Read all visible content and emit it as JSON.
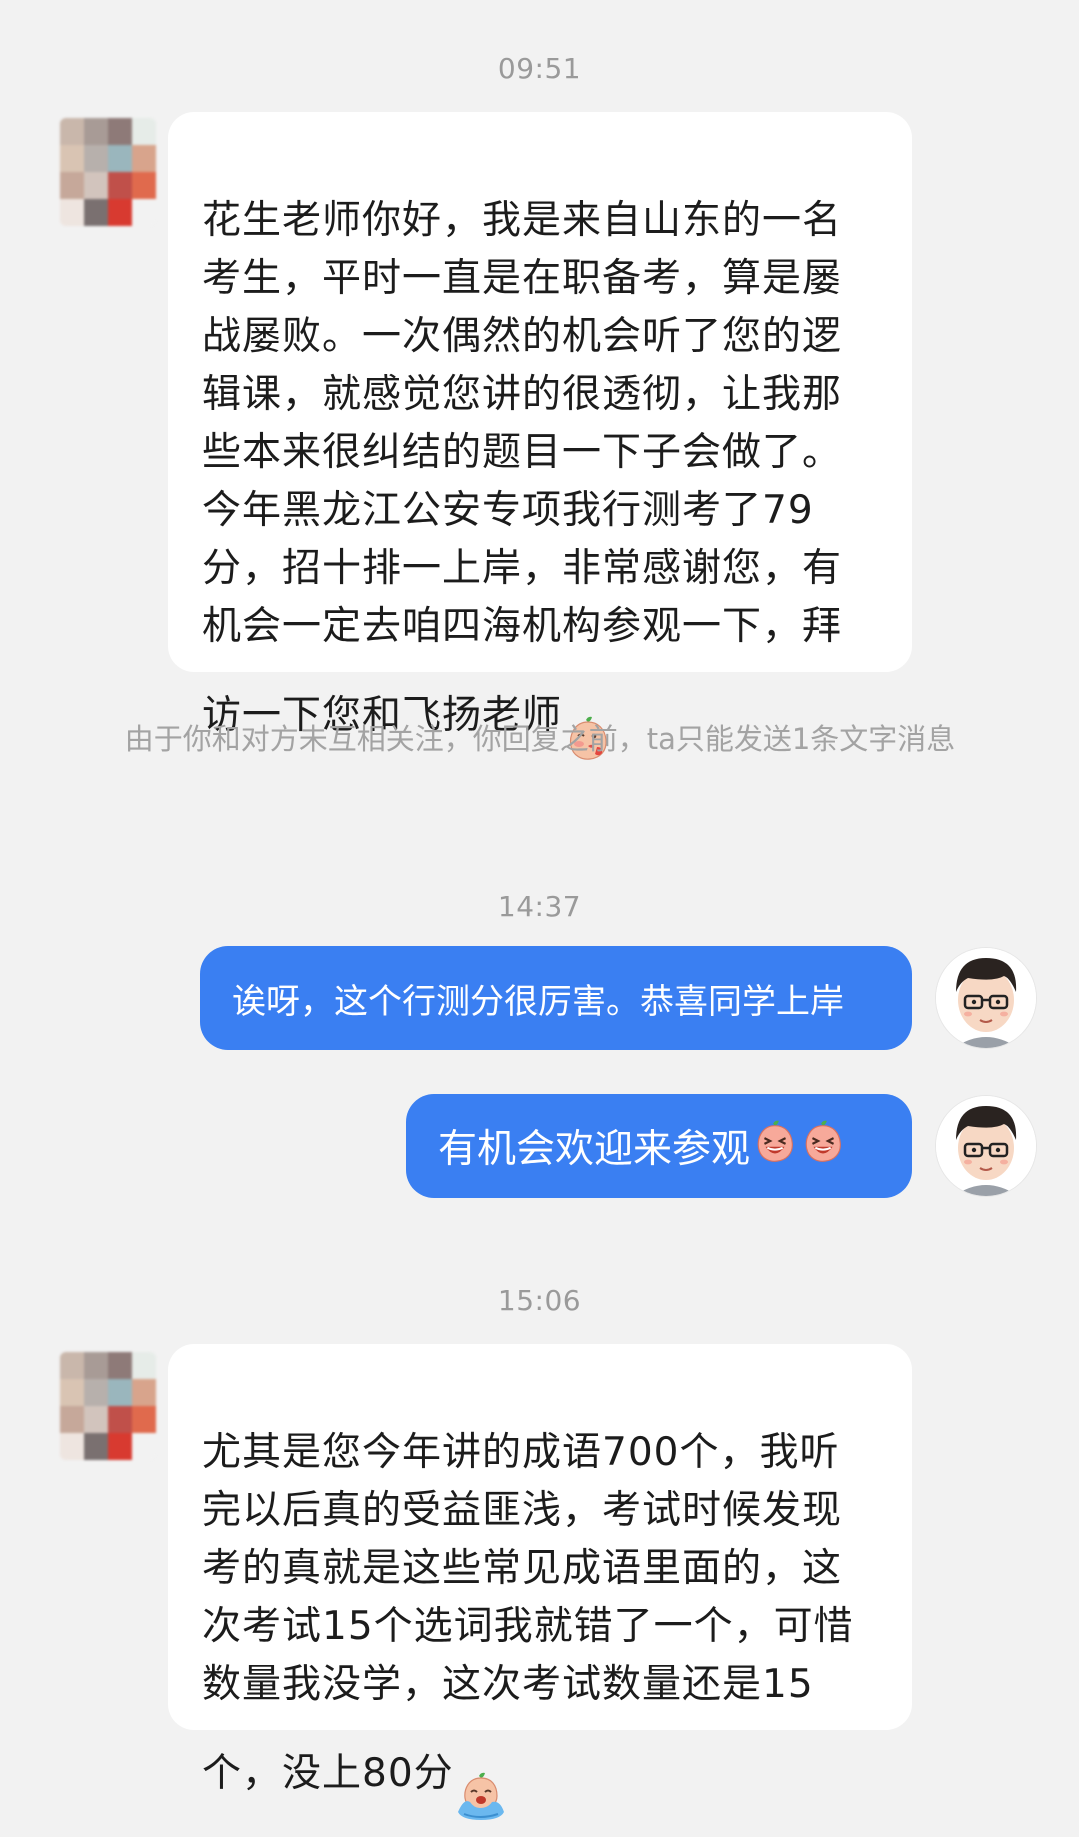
{
  "chat": {
    "timestamps": [
      "09:51",
      "14:37",
      "15:06"
    ],
    "messages": [
      {
        "sender": "student",
        "text": "花生老师你好，我是来自山东的一名\n考生，平时一直是在职备考，算是屡\n战屡败。一次偶然的机会听了您的逻\n辑课，就感觉您讲的很透彻，让我那\n些本来很纠结的题目一下子会做了。\n今年黑龙江公安专项我行测考了79\n分，招十排一上岸，非常感谢您，有\n机会一定去咱四海机构参观一下，拜\n访一下您和飞扬老师",
        "emoji": "blushing-peach-emoji"
      },
      {
        "sender": "teacher",
        "text": "诶呀，这个行测分很厉害。恭喜同学上岸"
      },
      {
        "sender": "teacher",
        "text": "有机会欢迎来参观",
        "emoji": "laughing-peach-emoji x2"
      },
      {
        "sender": "student",
        "text": "尤其是您今年讲的成语700个，我听\n完以后真的受益匪浅，考试时候发现\n考的真就是这些常见成语里面的，这\n次考试15个选词我就错了一个，可惜\n数量我没学，这次考试数量还是15\n个，没上80分",
        "emoji": "crying-peach-emoji"
      }
    ],
    "notice": "由于你和对方未互相关注，你回复之前，ta只能发送1条文字消息"
  },
  "colors": {
    "background": "#f2f2f2",
    "outgoing_bubble": "#3a7ff2",
    "incoming_bubble": "#ffffff",
    "timestamp_text": "#9a9a9a"
  }
}
